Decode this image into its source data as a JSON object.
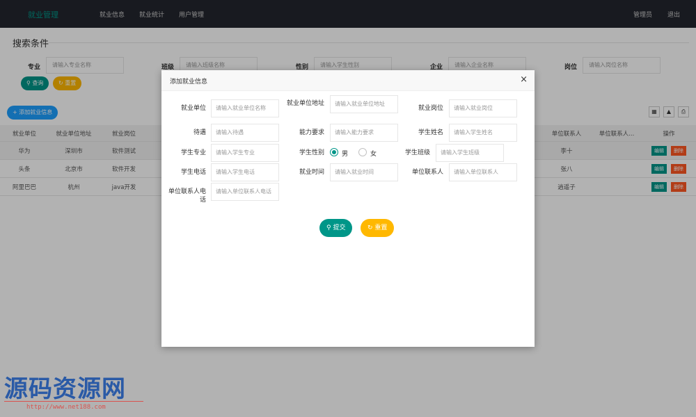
{
  "nav": {
    "brand": "就业管理",
    "items": [
      "就业信息",
      "就业统计",
      "用户管理"
    ],
    "admin": "管理员",
    "logout": "退出"
  },
  "search": {
    "title": "搜索条件",
    "fields": [
      {
        "label": "专业",
        "placeholder": "请输入专业名称"
      },
      {
        "label": "班级",
        "placeholder": "请输入班级名称"
      },
      {
        "label": "性别",
        "placeholder": "请输入学生性别"
      },
      {
        "label": "企业",
        "placeholder": "请输入企业名称"
      },
      {
        "label": "岗位",
        "placeholder": "请输入岗位名称"
      }
    ],
    "query_label": "查询",
    "reset_label": "重置"
  },
  "toolbar": {
    "add_label": "添加就业信息"
  },
  "table": {
    "headers": [
      "就业单位",
      "就业单位地址",
      "就业岗位",
      "单位联系人",
      "单位联系人...",
      "操作"
    ],
    "rows": [
      {
        "company": "华为",
        "address": "深圳市",
        "position": "软件测试",
        "contact": "李十"
      },
      {
        "company": "头条",
        "address": "北京市",
        "position": "软件开发",
        "contact": "张八"
      },
      {
        "company": "阿里巴巴",
        "address": "杭州",
        "position": "java开发",
        "contact": "逍遥子"
      }
    ],
    "edit_label": "编辑",
    "delete_label": "删除"
  },
  "modal": {
    "title": "添加就业信息",
    "close": "×",
    "fields": [
      {
        "label": "就业单位",
        "placeholder": "请输入就业单位名称"
      },
      {
        "label": "就业单位地址",
        "placeholder": "请输入就业单位地址"
      },
      {
        "label": "就业岗位",
        "placeholder": "请输入就业岗位"
      },
      {
        "label": "待遇",
        "placeholder": "请输入待遇"
      },
      {
        "label": "能力要求",
        "placeholder": "请输入能力要求"
      },
      {
        "label": "学生姓名",
        "placeholder": "请输入学生姓名"
      },
      {
        "label": "学生专业",
        "placeholder": "请输入学生专业"
      },
      {
        "label": "学生性别",
        "placeholder": ""
      },
      {
        "label": "学生班级",
        "placeholder": "请输入学生班级"
      },
      {
        "label": "学生电话",
        "placeholder": "请输入学生电话"
      },
      {
        "label": "就业时间",
        "placeholder": "请输入就业时间"
      },
      {
        "label": "单位联系人",
        "placeholder": "请输入单位联系人"
      },
      {
        "label": "单位联系人电话",
        "placeholder": "请输入单位联系人电话"
      }
    ],
    "gender_male": "男",
    "gender_female": "女",
    "gender_selected": "男",
    "submit_label": "提交",
    "reset_label": "重置"
  },
  "watermark": {
    "main": "源码资源网",
    "url": "http://www.net188.com"
  },
  "colors": {
    "primary": "#009688",
    "warning": "#ffb800",
    "blue": "#1e9fff",
    "danger": "#ff5722",
    "nav_bg": "#23262e"
  }
}
